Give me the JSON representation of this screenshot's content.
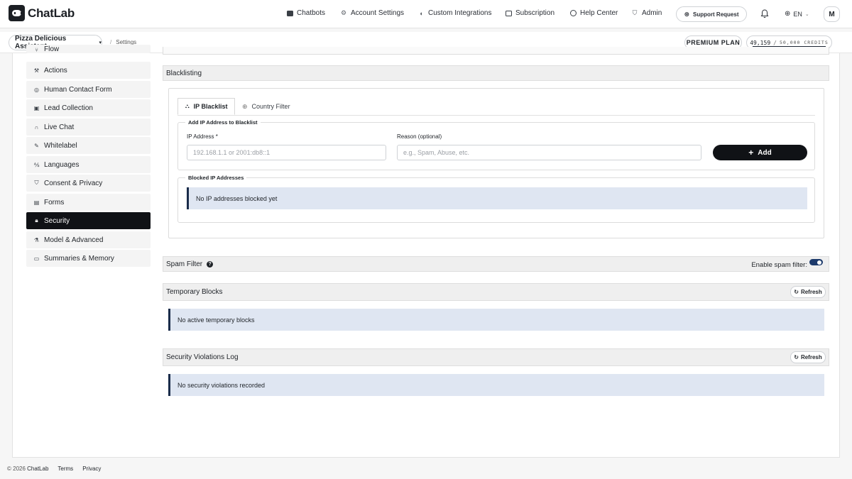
{
  "brand": {
    "name": "ChatLab"
  },
  "nav": {
    "chatbots": "Chatbots",
    "account_settings": "Account Settings",
    "custom_integrations": "Custom Integrations",
    "subscription": "Subscription",
    "help_center": "Help Center",
    "admin": "Admin",
    "support_request": "Support Request",
    "language": "EN",
    "avatar_initial": "M"
  },
  "subbar": {
    "bot_name": "Pizza Delicious Assistant",
    "breadcrumb": "Settings",
    "plan": "PREMIUM PLAN",
    "credits_used": "49,159",
    "credits_sep": "/",
    "credits_total": "50,000 CREDITS"
  },
  "sidebar": {
    "items": [
      {
        "label": "Flow",
        "icon": "flow-icon"
      },
      {
        "label": "Actions",
        "icon": "actions-icon"
      },
      {
        "label": "Human Contact Form",
        "icon": "contact-icon"
      },
      {
        "label": "Lead Collection",
        "icon": "lead-icon"
      },
      {
        "label": "Live Chat",
        "icon": "headset-icon"
      },
      {
        "label": "Whitelabel",
        "icon": "pencil-icon"
      },
      {
        "label": "Languages",
        "icon": "translate-icon"
      },
      {
        "label": "Consent & Privacy",
        "icon": "shield-icon"
      },
      {
        "label": "Forms",
        "icon": "form-icon"
      },
      {
        "label": "Security",
        "icon": "lock-icon"
      },
      {
        "label": "Model & Advanced",
        "icon": "flask-icon"
      },
      {
        "label": "Summaries & Memory",
        "icon": "memory-icon"
      }
    ]
  },
  "blacklisting": {
    "title": "Blacklisting",
    "tabs": [
      "IP Blacklist",
      "Country Filter"
    ],
    "add_legend": "Add IP Address to Blacklist",
    "ip_label": "IP Address *",
    "ip_placeholder": "192.168.1.1 or 2001:db8::1",
    "reason_label": "Reason (optional)",
    "reason_placeholder": "e.g., Spam, Abuse, etc.",
    "add_button": "Add",
    "blocked_legend": "Blocked IP Addresses",
    "blocked_empty": "No IP addresses blocked yet"
  },
  "spam_filter": {
    "title": "Spam Filter",
    "help": "?",
    "toggle_label": "Enable spam filter:",
    "enabled": true
  },
  "temporary_blocks": {
    "title": "Temporary Blocks",
    "refresh": "Refresh",
    "empty": "No active temporary blocks"
  },
  "violations": {
    "title": "Security Violations Log",
    "refresh": "Refresh",
    "empty": "No security violations recorded"
  },
  "footer": {
    "copyright": "© 2026",
    "brand": "ChatLab",
    "terms": "Terms",
    "privacy": "Privacy"
  }
}
